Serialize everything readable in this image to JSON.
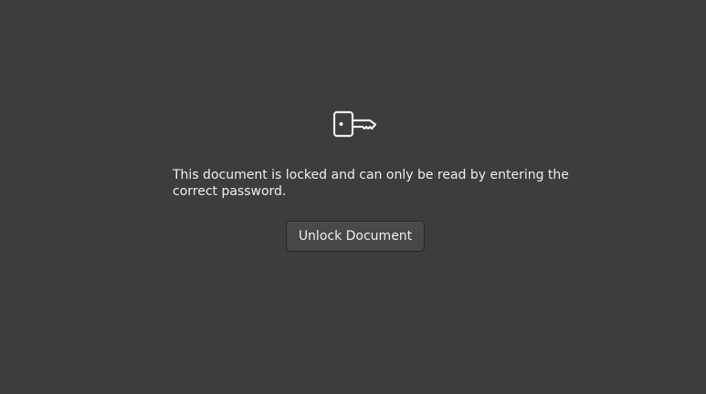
{
  "locked_view": {
    "icon": "key-icon",
    "message": "This document is locked and can only be read by entering the correct password.",
    "unlock_button_label": "Unlock Document"
  },
  "colors": {
    "background": "#3d3d3d",
    "text": "#eeeeec",
    "button_background": "#474747",
    "button_border": "#262626"
  }
}
